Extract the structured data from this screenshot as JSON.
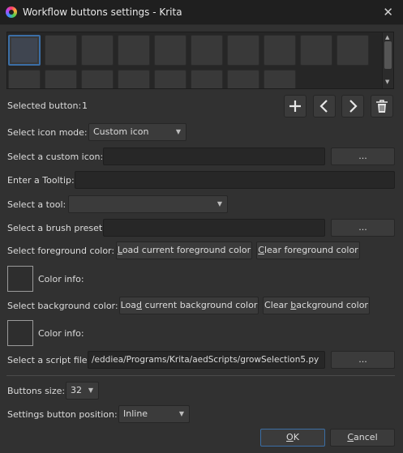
{
  "window": {
    "title": "Workflow buttons settings - Krita"
  },
  "selected_button": {
    "label": "Selected button:",
    "value": "1"
  },
  "icon_mode": {
    "label": "Select icon mode:",
    "value": "Custom icon"
  },
  "custom_icon": {
    "label": "Select a custom icon:",
    "value": "",
    "browse_label": "..."
  },
  "tooltip": {
    "label": "Enter a Tooltip:",
    "value": ""
  },
  "tool": {
    "label": "Select a tool:",
    "value": ""
  },
  "brush_preset": {
    "label": "Select a brush preset:",
    "value": "",
    "browse_label": "..."
  },
  "foreground": {
    "label": "Select foreground color:",
    "load_label": "Load current foreground color",
    "clear_label": "Clear foreground color",
    "info_label": "Color info:"
  },
  "background": {
    "label": "Select background color:",
    "load_label": "Load current background color",
    "clear_label": "Clear background color",
    "info_label": "Color info:"
  },
  "script_file": {
    "label": "Select a script file:",
    "value": "/eddiea/Programs/Krita/aedScripts/growSelection5.py",
    "browse_label": "..."
  },
  "buttons_size": {
    "label": "Buttons size:",
    "value": "32"
  },
  "settings_position": {
    "label": "Settings button position:",
    "value": "Inline"
  },
  "footer": {
    "ok_label": "OK",
    "cancel_label": "Cancel"
  },
  "icons": {
    "add": "plus-icon",
    "previous": "chevron-left-icon",
    "next": "chevron-right-icon",
    "delete": "trash-icon",
    "close": "close-icon"
  }
}
